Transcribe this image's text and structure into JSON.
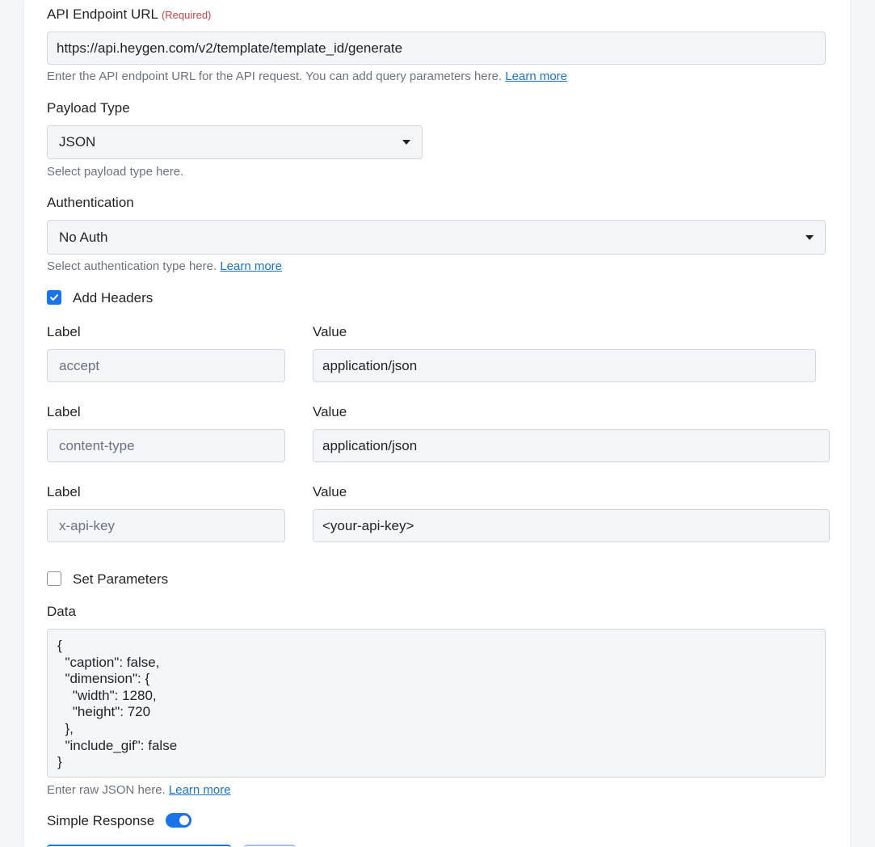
{
  "endpoint": {
    "label": "API Endpoint URL",
    "required": "(Required)",
    "value": "https://api.heygen.com/v2/template/template_id/generate",
    "help": "Enter the API endpoint URL for the API request. You can add query parameters here.",
    "help_link": "Learn more"
  },
  "payload": {
    "label": "Payload Type",
    "value": "JSON",
    "help": "Select payload type here."
  },
  "auth": {
    "label": "Authentication",
    "value": "No Auth",
    "help": "Select authentication type here.",
    "help_link": "Learn more"
  },
  "headers": {
    "checkbox_label": "Add Headers",
    "checked": true,
    "label_caption": "Label",
    "value_caption": "Value",
    "rows": [
      {
        "label": "accept",
        "value": "application/json"
      },
      {
        "label": "content-type",
        "value": "application/json"
      },
      {
        "label": "x-api-key",
        "value": "<your-api-key>"
      }
    ]
  },
  "parameters": {
    "checkbox_label": "Set Parameters",
    "checked": false
  },
  "data": {
    "label": "Data",
    "value": "{\n  \"caption\": false,\n  \"dimension\": {\n    \"width\": 1280,\n    \"height\": 720\n  },\n  \"include_gif\": false\n}",
    "help": "Enter raw JSON here.",
    "help_link": "Learn more"
  },
  "simple_response": {
    "label": "Simple Response",
    "enabled": true
  },
  "colors": {
    "accent": "#1a73e8",
    "link": "#1a73c8",
    "required": "#d14343"
  }
}
